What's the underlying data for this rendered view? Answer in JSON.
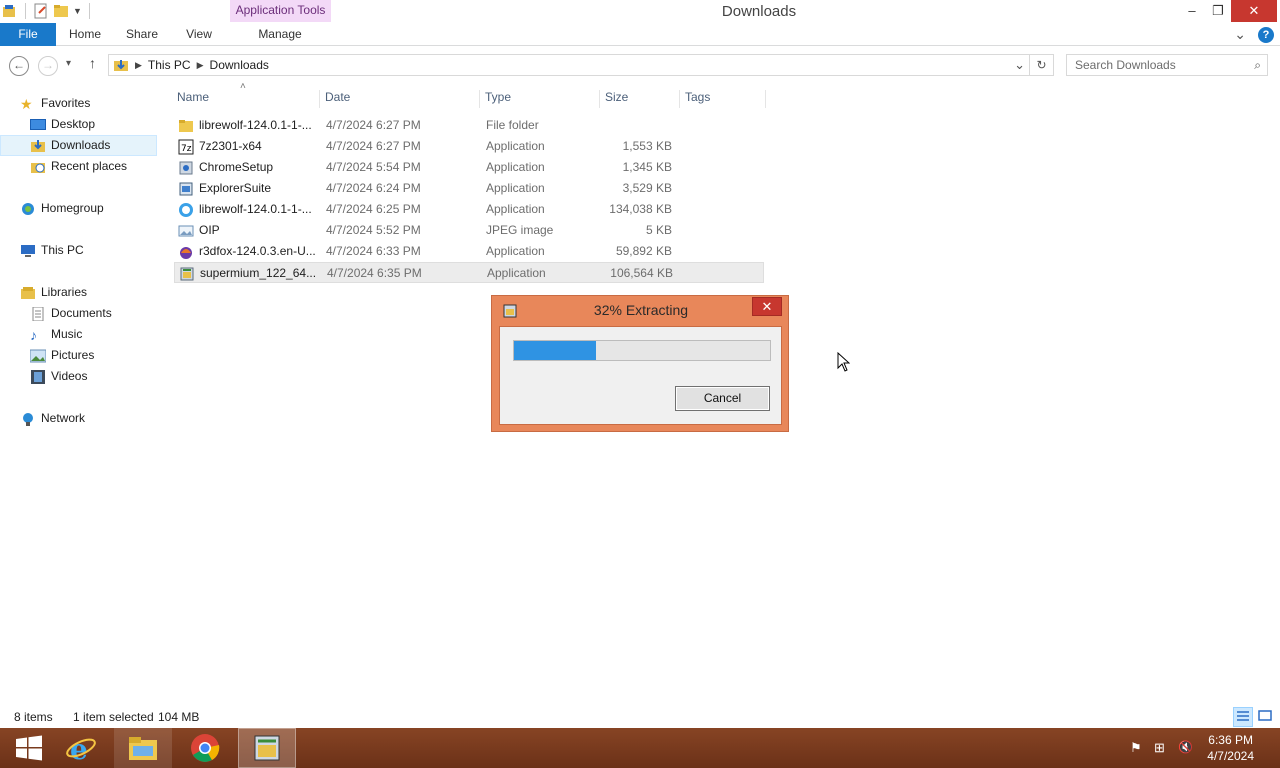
{
  "window": {
    "title": "Downloads",
    "context_tab": "Application Tools",
    "minimize_glyph": "–",
    "restore_glyph": "❐",
    "close_glyph": "✕"
  },
  "ribbon": {
    "tabs": [
      "File",
      "Home",
      "Share",
      "View",
      "Manage"
    ],
    "expand_glyph": "⌄",
    "help_glyph": "?"
  },
  "address": {
    "back_glyph": "←",
    "forward_glyph": "→",
    "recent_glyph": "▾",
    "up_glyph": "↑",
    "crumbs": [
      "This PC",
      "Downloads"
    ],
    "dropdown_glyph": "⌄",
    "refresh_glyph": "↻",
    "search_placeholder": "Search Downloads",
    "search_glyph": "⌕"
  },
  "nav_pane": {
    "favorites": "Favorites",
    "desktop": "Desktop",
    "downloads": "Downloads",
    "recent": "Recent places",
    "homegroup": "Homegroup",
    "thispc": "This PC",
    "libraries": "Libraries",
    "documents": "Documents",
    "music": "Music",
    "pictures": "Pictures",
    "videos": "Videos",
    "network": "Network"
  },
  "file_list": {
    "sort_glyph": "˄",
    "columns": [
      "Name",
      "Date",
      "Type",
      "Size",
      "Tags"
    ],
    "rows": [
      {
        "name": "librewolf-124.0.1-1-...",
        "date": "4/7/2024 6:27 PM",
        "type": "File folder",
        "size": "",
        "icon": "folder-icon"
      },
      {
        "name": "7z2301-x64",
        "date": "4/7/2024 6:27 PM",
        "type": "Application",
        "size": "1,553 KB",
        "icon": "7zip-icon"
      },
      {
        "name": "ChromeSetup",
        "date": "4/7/2024 5:54 PM",
        "type": "Application",
        "size": "1,345 KB",
        "icon": "installer-icon"
      },
      {
        "name": "ExplorerSuite",
        "date": "4/7/2024 6:24 PM",
        "type": "Application",
        "size": "3,529 KB",
        "icon": "installer-icon"
      },
      {
        "name": "librewolf-124.0.1-1-...",
        "date": "4/7/2024 6:25 PM",
        "type": "Application",
        "size": "134,038 KB",
        "icon": "librewolf-icon"
      },
      {
        "name": "OIP",
        "date": "4/7/2024 5:52 PM",
        "type": "JPEG image",
        "size": "5 KB",
        "icon": "image-icon"
      },
      {
        "name": "r3dfox-124.0.3.en-U...",
        "date": "4/7/2024 6:33 PM",
        "type": "Application",
        "size": "59,892 KB",
        "icon": "r3dfox-icon"
      },
      {
        "name": "supermium_122_64...",
        "date": "4/7/2024 6:35 PM",
        "type": "Application",
        "size": "106,564 KB",
        "icon": "installer-icon"
      }
    ]
  },
  "dialog": {
    "title": "32% Extracting",
    "progress": 0.32,
    "cancel_label": "Cancel",
    "close_glyph": "✕"
  },
  "status_bar": {
    "item_count": "8 items",
    "selection": "1 item selected",
    "selection_size": "104 MB"
  },
  "taskbar": {
    "time": "6:36 PM",
    "date": "4/7/2024",
    "tray_flag": "⚑",
    "tray_network": "⊞",
    "tray_volume": "🔇"
  },
  "colors": {
    "accent": "#1979ca",
    "dialog_frame": "#e8875a",
    "taskbar": "#7b3a1d",
    "progress_fill": "#2f93e3"
  }
}
